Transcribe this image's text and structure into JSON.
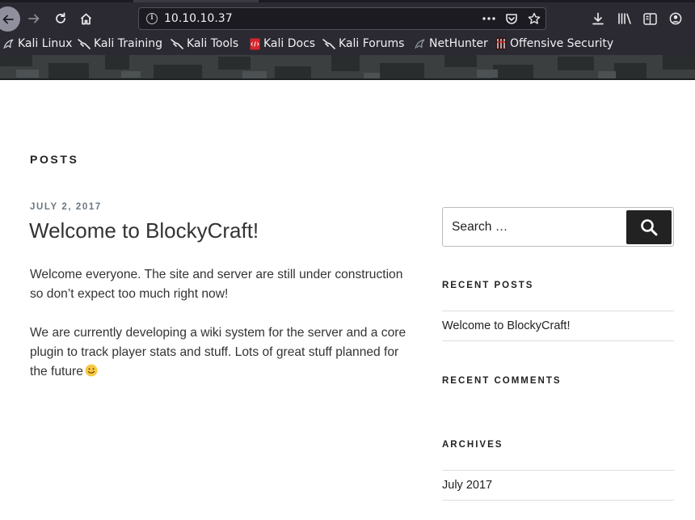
{
  "browser": {
    "url": "10.10.10.37",
    "bookmarks": [
      {
        "label": "Kali Linux",
        "icon": "kali-dragon-icon"
      },
      {
        "label": "Kali Training",
        "icon": "kali-dragon-icon"
      },
      {
        "label": "Kali Tools",
        "icon": "kali-dragon-icon"
      },
      {
        "label": "Kali Docs",
        "icon": "kali-docs-icon"
      },
      {
        "label": "Kali Forums",
        "icon": "kali-dragon-icon"
      },
      {
        "label": "NetHunter",
        "icon": "nethunter-icon"
      },
      {
        "label": "Offensive Security",
        "icon": "offsec-icon"
      }
    ]
  },
  "main": {
    "section_heading": "POSTS",
    "post": {
      "date": "JULY 2, 2017",
      "title": "Welcome to BlockyCraft!",
      "paragraphs": [
        "Welcome everyone. The site and server are still under construction so don’t expect too much right now!",
        "We are currently developing a wiki system for the server and a core plugin to track player stats and stuff. Lots of great stuff planned for the future"
      ]
    }
  },
  "sidebar": {
    "search": {
      "placeholder": "Search …"
    },
    "recent_posts": {
      "title": "RECENT POSTS",
      "items": [
        "Welcome to BlockyCraft!"
      ]
    },
    "recent_comments": {
      "title": "RECENT COMMENTS"
    },
    "archives": {
      "title": "ARCHIVES",
      "items": [
        "July 2017"
      ]
    }
  },
  "colors": {
    "chrome_bg": "#2b2a33",
    "urlbar_bg": "#1c1b22",
    "text_dark": "#222222",
    "date_gray": "#6c7781",
    "search_button": "#222222"
  }
}
